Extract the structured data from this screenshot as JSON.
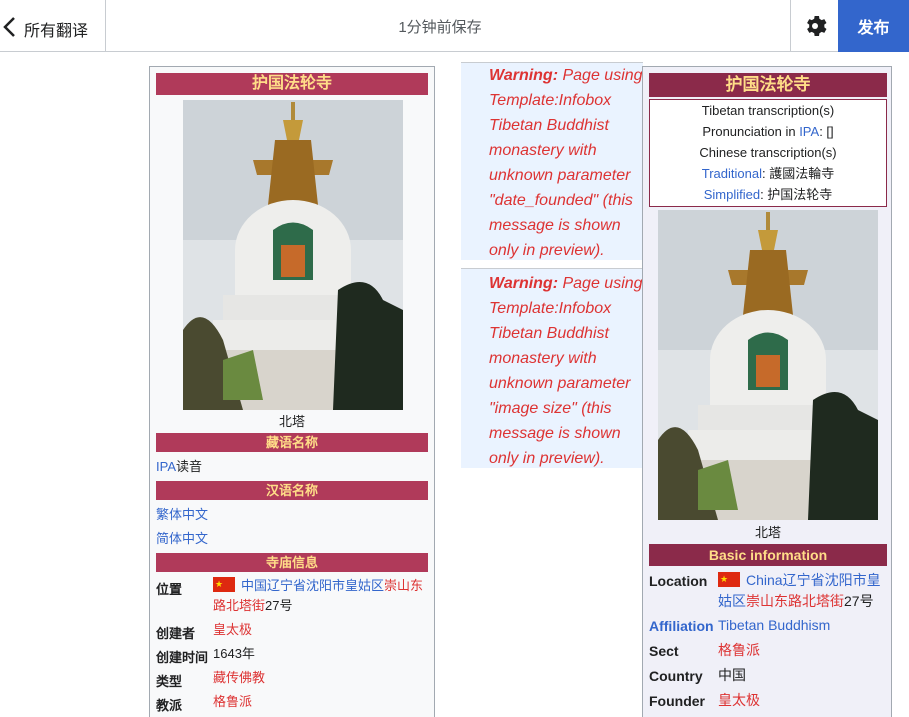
{
  "topbar": {
    "back_label": "所有翻译",
    "save_status": "1分钟前保存",
    "publish_label": "发布"
  },
  "left_infobox": {
    "title": "护国法轮寺",
    "caption": "北塔",
    "tibetan_header": "藏语名称",
    "ipa_link": "IPA",
    "ipa_suffix": "读音",
    "chinese_header": "汉语名称",
    "traditional": "繁体中文",
    "simplified": "简体中文",
    "temple_header": "寺庙信息",
    "location_label": "位置",
    "location_link": "中国辽宁省沈阳市皇姑区",
    "location_red": "崇山东路北塔街",
    "location_suffix": "27号",
    "founder_label": "创建者",
    "founder_value": "皇太极",
    "founded_label": "创建时间",
    "founded_value": "1643年",
    "type_label": "类型",
    "type_value": "藏传佛教",
    "sect_label": "教派",
    "sect_value": "格鲁派"
  },
  "warnings": [
    {
      "bold": "Warning:",
      "text": " Page using Template:Infobox Tibetan Buddhist monastery with unknown parameter \"date_founded\" (this message is shown only in preview)."
    },
    {
      "bold": "Warning:",
      "text": " Page using Template:Infobox Tibetan Buddhist monastery with unknown parameter \"image size\" (this message is shown only in preview)."
    }
  ],
  "right_infobox": {
    "title": "护国法轮寺",
    "tibetan_transcription": "Tibetan transcription(s)",
    "pronunciation_prefix": "Pronunciation in ",
    "pronunciation_link": "IPA",
    "pronunciation_suffix": ": []",
    "chinese_transcription": "Chinese transcription(s)",
    "traditional_link": "Traditional",
    "traditional_value": ": 護國法輪寺",
    "simplified_link": "Simplified",
    "simplified_value": ": 护国法轮寺",
    "caption": "北塔",
    "basic_header": "Basic information",
    "location_label": "Location",
    "location_link": "China辽宁省沈阳市皇姑区",
    "location_red": "崇山东路北塔街",
    "location_suffix": "27号",
    "affiliation_label": "Affiliation",
    "affiliation_value": "Tibetan Buddhism",
    "sect_label": "Sect",
    "sect_value": "格鲁派",
    "country_label": "Country",
    "country_value": "中国",
    "founder_label": "Founder",
    "founder_value": "皇太极"
  },
  "colors": {
    "accent_blue": "#3366cc",
    "infobox_header": "#b03a5a",
    "header_text": "#ffdd88",
    "warning_red": "#d33"
  },
  "icons": [
    "chevron-left-icon",
    "gear-icon",
    "china-flag-icon"
  ]
}
